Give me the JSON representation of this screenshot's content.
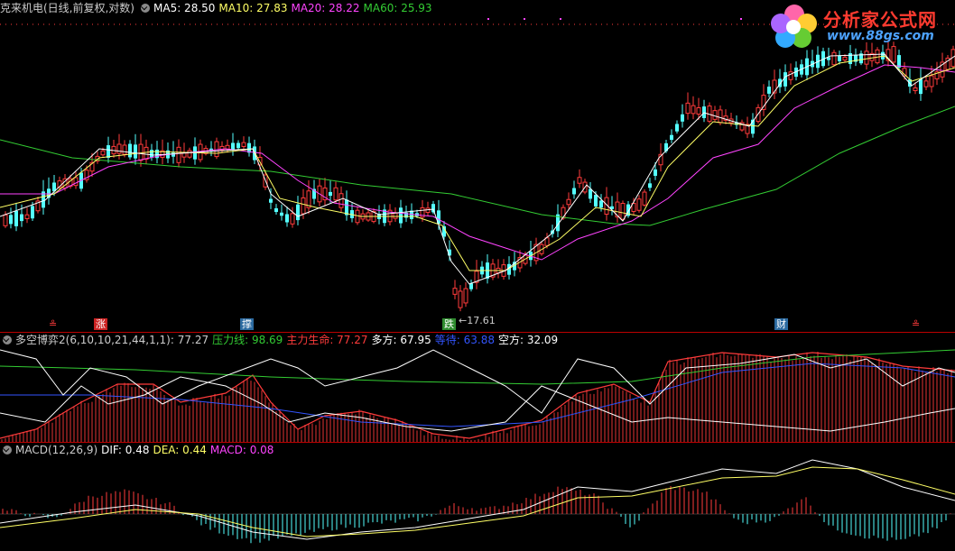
{
  "main": {
    "title": "克来机电(日线,前复权,对数)",
    "ma": [
      {
        "label": "MA5: 28.50",
        "color": "#ffffff"
      },
      {
        "label": "MA10: 27.83",
        "color": "#ffff66"
      },
      {
        "label": "MA20: 28.22",
        "color": "#ff44ff"
      },
      {
        "label": "MA60: 25.93",
        "color": "#33cc33"
      }
    ],
    "low_label": "17.61",
    "signals": [
      {
        "text": "≗",
        "color": "#ff3b3b",
        "bg": "transparent"
      },
      {
        "text": "涨",
        "color": "#ffffff",
        "bg": "#cc2222"
      },
      {
        "text": "撑",
        "color": "#ffffff",
        "bg": "#2b6aa0"
      },
      {
        "text": "跌",
        "color": "#ffffff",
        "bg": "#2e8b2e"
      },
      {
        "text": "财",
        "color": "#ffffff",
        "bg": "#2b6aa0"
      },
      {
        "text": "≗",
        "color": "#ff3b3b",
        "bg": "transparent"
      }
    ]
  },
  "indicator": {
    "title": "多空博弈2(6,10,10,21,44,1,1)",
    "value": ": 77.27",
    "fields": [
      {
        "label": "压力线: 98.69",
        "color": "#33cc33"
      },
      {
        "label": "主力生命: 77.27",
        "color": "#ff3b3b"
      },
      {
        "label": "多方: 67.95",
        "color": "#ffffff"
      },
      {
        "label": "等待: 63.88",
        "color": "#3355ff"
      },
      {
        "label": "空方: 32.09",
        "color": "#ffffff"
      }
    ]
  },
  "macd": {
    "title": "MACD(12,26,9)",
    "fields": [
      {
        "label": "DIF: 0.48",
        "color": "#ffffff"
      },
      {
        "label": "DEA: 0.44",
        "color": "#ffff66"
      },
      {
        "label": "MACD: 0.08",
        "color": "#ff44ff"
      }
    ]
  },
  "logo": {
    "text": "分析家公式网",
    "url": "www.88gs.com"
  },
  "colors": {
    "up": "#ff3b3b",
    "down": "#54ffff",
    "ma5": "#ffffff",
    "ma10": "#ffff66",
    "ma20": "#ff44ff",
    "ma60": "#33cc33",
    "blue": "#3355ff",
    "dotline": "#ff3b3b"
  }
}
